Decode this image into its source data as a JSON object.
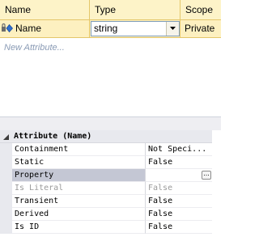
{
  "grid": {
    "columns": [
      "Name",
      "Type",
      "Scope"
    ],
    "rows": [
      {
        "icon": "attribute-icon",
        "name": "Name",
        "type": "string",
        "scope": "Private"
      }
    ],
    "new_placeholder": "New Attribute..."
  },
  "properties": {
    "category": "Attribute (Name)",
    "items": [
      {
        "name": "Containment",
        "value": "Not Speci..."
      },
      {
        "name": "Static",
        "value": "False"
      },
      {
        "name": "Property",
        "value": "",
        "has_button": true,
        "button_label": "..."
      },
      {
        "name": "Is Literal",
        "value": "False",
        "disabled": true
      },
      {
        "name": "Transient",
        "value": "False"
      },
      {
        "name": "Derived",
        "value": "False"
      },
      {
        "name": "Is ID",
        "value": "False"
      }
    ]
  },
  "colors": {
    "header_bg": "#fdf3c8",
    "row_bg": "#fdf0c0",
    "placeholder_text": "#8a9bb5",
    "selected_row": "#c4c7d4"
  }
}
